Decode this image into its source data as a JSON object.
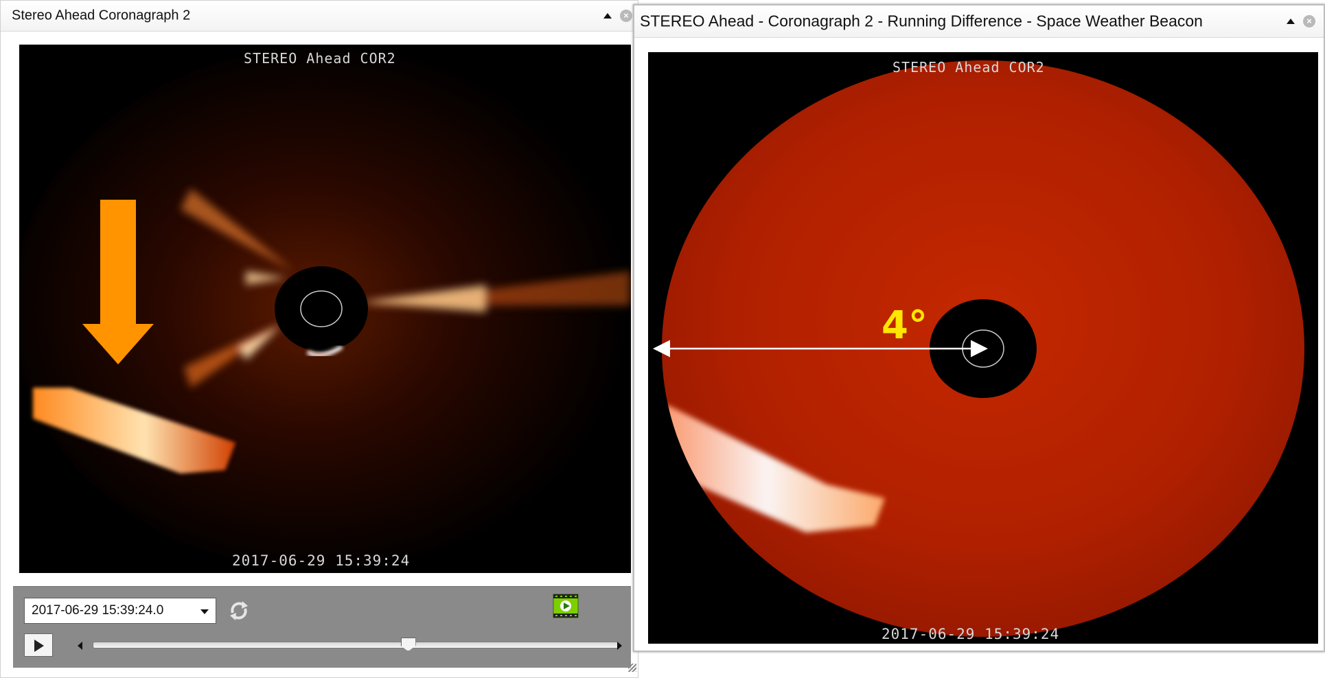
{
  "left_window": {
    "title": "Stereo Ahead Coronagraph 2",
    "image_top_label": "STEREO Ahead COR2",
    "image_bottom_label": "2017-06-29 15:39:24",
    "controls": {
      "date_value": "2017-06-29 15:39:24.0",
      "slider_position_fraction": 0.6
    }
  },
  "right_window": {
    "title": "STEREO Ahead - Coronagraph 2 - Running Difference - Space Weather Beacon",
    "image_top_label": "STEREO Ahead COR2",
    "image_bottom_label": "2017-06-29 15:39:24",
    "annotation_label": "4°"
  },
  "colors": {
    "annotation_arrow": "#ff9400",
    "annotation_text": "#ffe600",
    "movie_icon": "#7cd000"
  },
  "icons": {
    "collapse": "triangle-up-icon",
    "close": "close-circle-icon",
    "refresh": "refresh-icon",
    "movie": "movie-icon",
    "play": "play-icon"
  }
}
